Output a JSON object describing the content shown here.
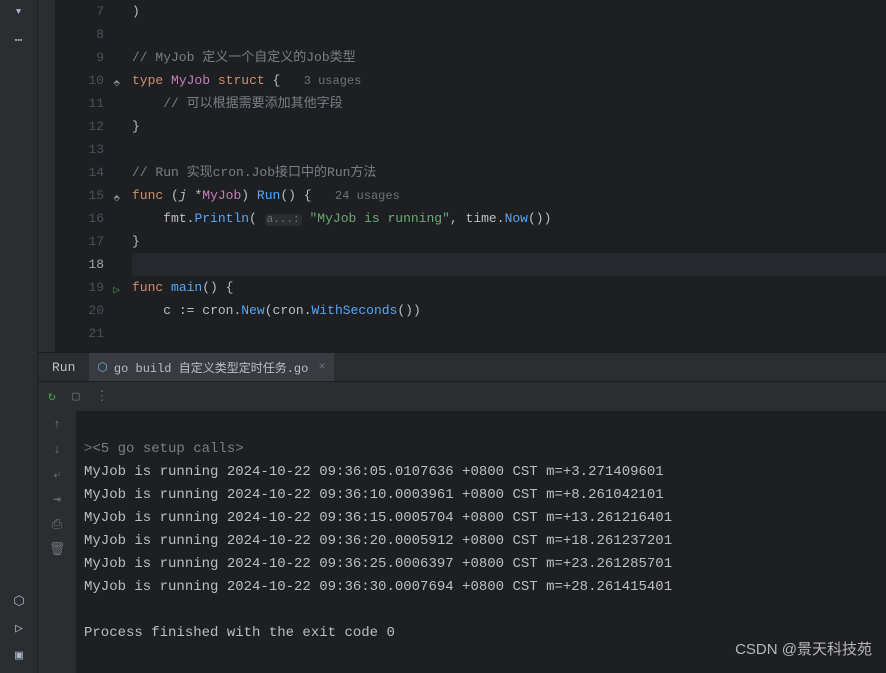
{
  "gutter": {
    "start": 7,
    "end": 21
  },
  "code": {
    "l7": ")",
    "l9_comment": "// MyJob 定义一个自定义的Job类型",
    "l10_type": "type",
    "l10_name": "MyJob",
    "l10_struct": "struct",
    "l10_brace": "{",
    "l10_usages": "3 usages",
    "l11_comment": "// 可以根据需要添加其他字段",
    "l12": "}",
    "l14_comment": "// Run 实现cron.Job接口中的Run方法",
    "l15_func": "func",
    "l15_recv": "(j *MyJob)",
    "l15_name": "Run",
    "l15_params": "()",
    "l15_brace": "{",
    "l15_usages": "24 usages",
    "l16_pkg": "fmt",
    "l16_fn": "Println",
    "l16_hint": "a...:",
    "l16_str": "\"MyJob is running\"",
    "l16_pkg2": "time",
    "l16_fn2": "Now",
    "l17": "}",
    "l19_func": "func",
    "l19_name": "main",
    "l19_params": "()",
    "l19_brace": "{",
    "l20_var": "c",
    "l20_assign": ":=",
    "l20_pkg": "cron",
    "l20_fn": "New",
    "l20_pkg2": "cron",
    "l20_fn2": "WithSeconds"
  },
  "run": {
    "tab_label": "Run",
    "file_tab": "go build 自定义类型定时任务.go",
    "setup": "<5 go setup calls>",
    "lines": [
      "MyJob is running 2024-10-22 09:36:05.0107636 +0800 CST m=+3.271409601",
      "MyJob is running 2024-10-22 09:36:10.0003961 +0800 CST m=+8.261042101",
      "MyJob is running 2024-10-22 09:36:15.0005704 +0800 CST m=+13.261216401",
      "MyJob is running 2024-10-22 09:36:20.0005912 +0800 CST m=+18.261237201",
      "MyJob is running 2024-10-22 09:36:25.0006397 +0800 CST m=+23.261285701",
      "MyJob is running 2024-10-22 09:36:30.0007694 +0800 CST m=+28.261415401"
    ],
    "exit": "Process finished with the exit code 0"
  },
  "watermark": "CSDN @景天科技苑"
}
